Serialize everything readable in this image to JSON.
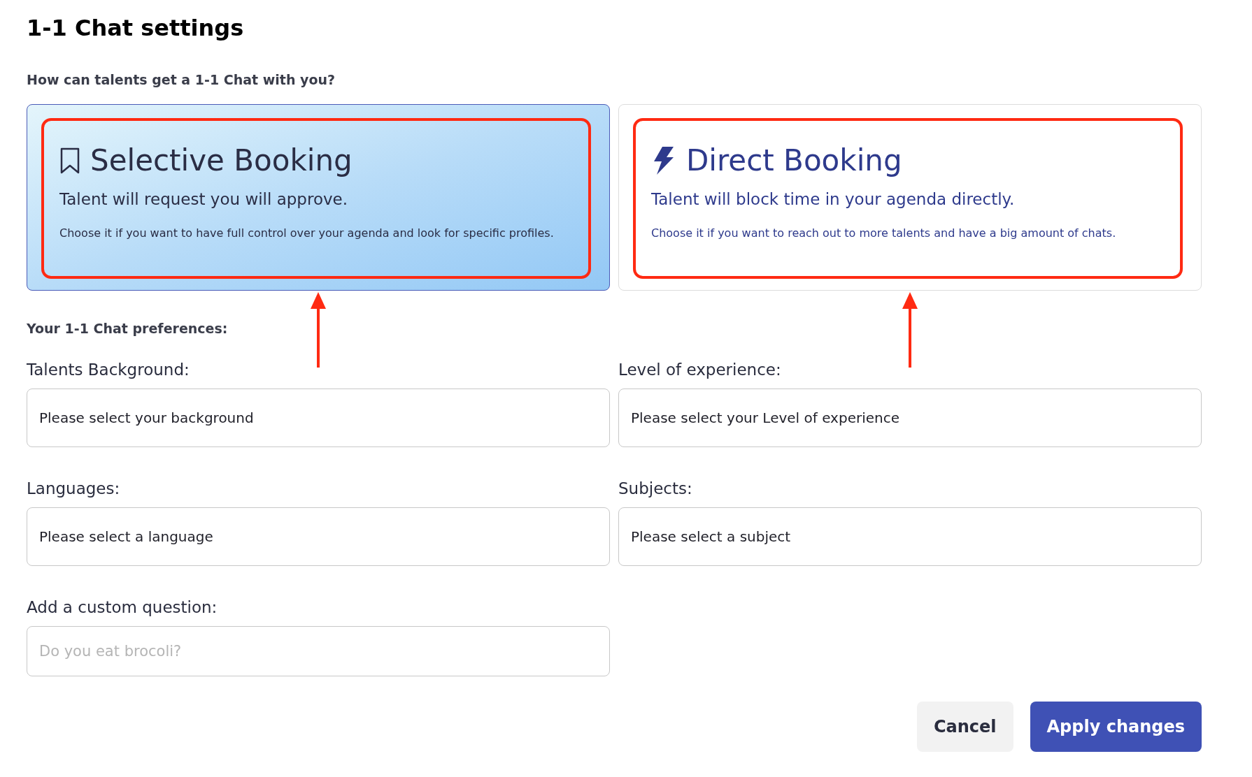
{
  "title": "1-1 Chat settings",
  "booking_question": "How can talents get a 1-1 Chat with you?",
  "booking_options": [
    {
      "kind": "bookmark",
      "title": "Selective Booking",
      "subtitle": "Talent will request you will approve.",
      "description": "Choose it if you want to have full control over your agenda and look for specific profiles.",
      "selected": true,
      "annotated": true
    },
    {
      "kind": "bolt",
      "title": "Direct Booking",
      "subtitle": "Talent will block time in your agenda directly.",
      "description": "Choose it if you want to reach out to more talents and have a big amount of chats.",
      "selected": false,
      "annotated": true
    }
  ],
  "preferences_heading": "Your 1-1 Chat preferences:",
  "fields": [
    {
      "label": "Talents Background:",
      "value": "Please select your background"
    },
    {
      "label": "Level of experience:",
      "value": "Please select your Level of experience"
    },
    {
      "label": "Languages:",
      "value": "Please select a language"
    },
    {
      "label": "Subjects:",
      "value": "Please select a subject"
    },
    {
      "label": "Add a custom question:",
      "placeholder": "Do you eat brocoli?"
    }
  ],
  "buttons": [
    {
      "label": "Cancel",
      "kind": "secondary"
    },
    {
      "label": "Apply changes",
      "kind": "primary"
    }
  ]
}
